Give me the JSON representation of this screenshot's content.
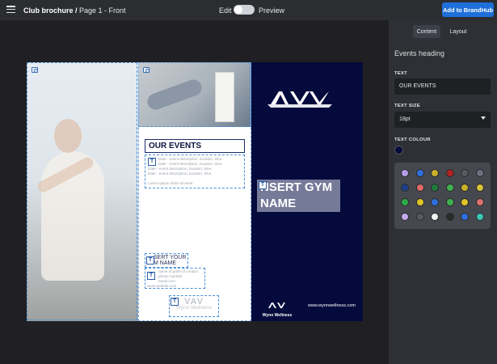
{
  "topbar": {
    "doc_title": "Club brochure /",
    "page_label": "Page 1 - Front",
    "edit_label": "Edit",
    "preview_label": "Preview",
    "add_button": "Add to BrandHub"
  },
  "document": {
    "events_title": "OUR EVENTS",
    "event_lines": [
      "Date - event description, location, time.",
      "Date - event description, location, time.",
      "Date - event description, location, time.",
      "Date - event description, location, time."
    ],
    "lorem_line": "Lorem ipsum dolor sit amet",
    "insert_your_line1": "SERT YOUR",
    "insert_your_line2": "M NAME",
    "contact_lines": [
      "name of point of contact",
      "phone number",
      "email.com",
      "www.website.com"
    ],
    "logo_name": "Wynn Wellness",
    "gym_line1": "NSERT GYM",
    "gym_line2": "NAME",
    "small_logo_name": "Wynn Wellness",
    "url": "www.wynnwellness.com",
    "logo_mark": "VAV"
  },
  "panel": {
    "tab_content": "Content",
    "tab_layout": "Layout",
    "heading": "Events heading",
    "text_label": "TEXT",
    "text_value": "OUR EVENTS",
    "size_label": "TEXT SIZE",
    "size_value": "18pt",
    "colour_label": "TEXT COLOUR",
    "current_colour": "#050a3c",
    "palette": [
      [
        "#b49be8",
        "#2f6fe0",
        "#c9b028",
        "#b32222",
        "#555a63",
        "#6a7080"
      ],
      [
        "#1d3f8a",
        "#e06b6b",
        "#1f7a3a",
        "#3fb24f",
        "#c9b028",
        "#d8c23a"
      ],
      [
        "#2faa4b",
        "#e0c428",
        "#2f6fe0",
        "#3fb24f",
        "#e0c428",
        "#e07070"
      ],
      [
        "#c4a9ec",
        "#555a63",
        "#f2f2f2",
        "#2a2a2a",
        "#2f6fe0",
        "#3cc7b8"
      ]
    ]
  }
}
